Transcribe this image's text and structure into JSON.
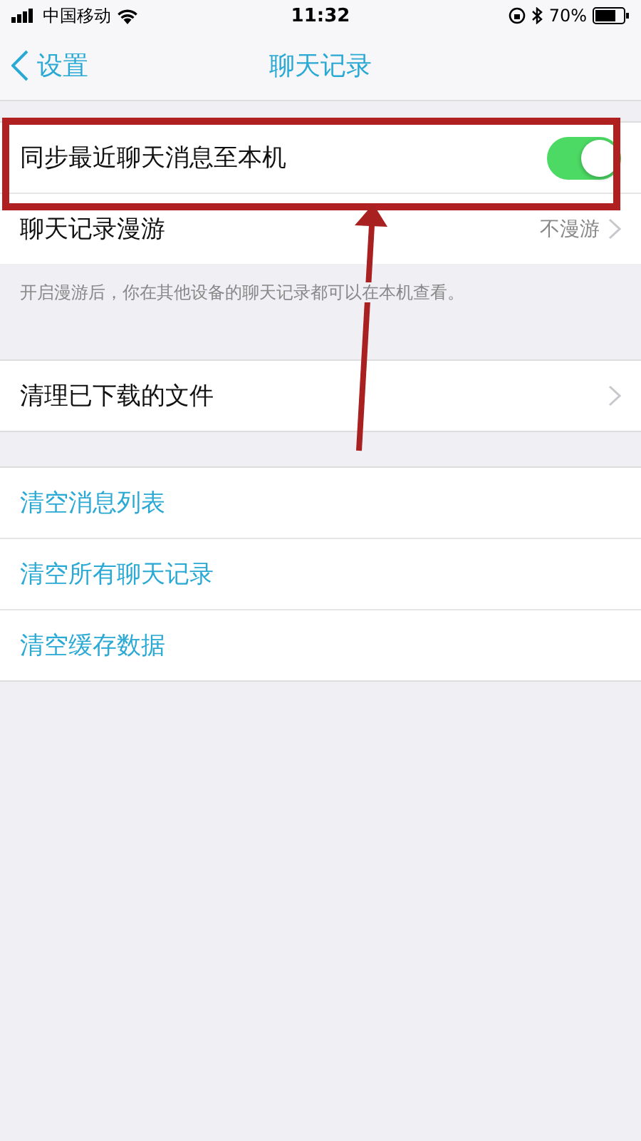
{
  "status_bar": {
    "carrier": "中国移动",
    "time": "11:32",
    "battery": "70%"
  },
  "nav": {
    "back": "设置",
    "title": "聊天记录"
  },
  "sections": [
    {
      "rows": [
        {
          "kind": "toggle",
          "label": "同步最近聊天消息至本机",
          "on": true
        },
        {
          "kind": "link",
          "label": "聊天记录漫游",
          "value": "不漫游"
        }
      ],
      "footer": "开启漫游后，你在其他设备的聊天记录都可以在本机查看。"
    },
    {
      "rows": [
        {
          "kind": "link",
          "label": "清理已下载的文件"
        }
      ]
    },
    {
      "rows": [
        {
          "kind": "action",
          "label": "清空消息列表"
        },
        {
          "kind": "action",
          "label": "清空所有聊天记录"
        },
        {
          "kind": "action",
          "label": "清空缓存数据"
        }
      ]
    }
  ]
}
